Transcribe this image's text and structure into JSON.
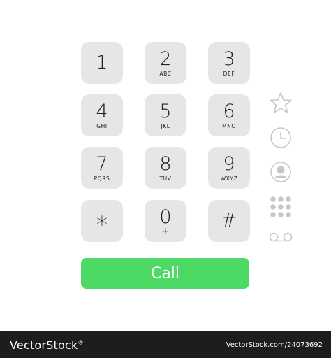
{
  "keypad": [
    {
      "digit": "1",
      "letters": ""
    },
    {
      "digit": "2",
      "letters": "ABC"
    },
    {
      "digit": "3",
      "letters": "DEF"
    },
    {
      "digit": "4",
      "letters": "GHI"
    },
    {
      "digit": "5",
      "letters": "JKL"
    },
    {
      "digit": "6",
      "letters": "MNO"
    },
    {
      "digit": "7",
      "letters": "PQRS"
    },
    {
      "digit": "8",
      "letters": "TUV"
    },
    {
      "digit": "9",
      "letters": "WXYZ"
    },
    {
      "digit": "*",
      "letters": ""
    },
    {
      "digit": "0",
      "letters": "+"
    },
    {
      "digit": "#",
      "letters": ""
    }
  ],
  "call_button": {
    "label": "Call",
    "color": "#4cd964"
  },
  "side_icons": [
    "favorites-star-icon",
    "recents-clock-icon",
    "contacts-person-icon",
    "keypad-grid-icon",
    "voicemail-icon"
  ],
  "colors": {
    "key_bg": "#e6e6e6",
    "icon_gray": "#c7c7c7"
  },
  "watermark": {
    "brand": "VectorStock",
    "registered": "®",
    "url": "VectorStock.com/24073692"
  }
}
